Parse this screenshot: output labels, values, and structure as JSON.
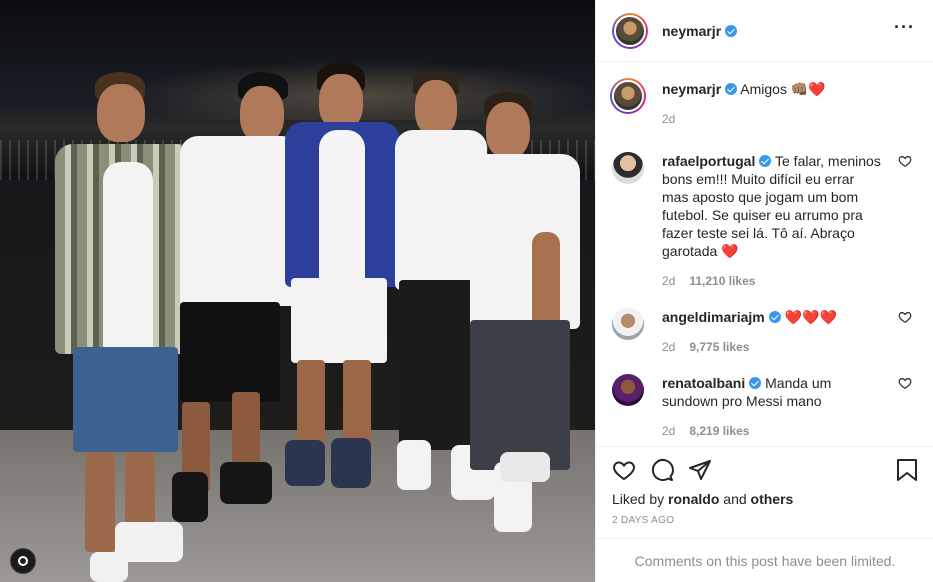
{
  "post": {
    "author": "neymarjr",
    "caption": "Amigos",
    "caption_emojis": "👊🏽❤️",
    "caption_time": "2d"
  },
  "comments": [
    {
      "user": "rafaelportugal",
      "text": "Te falar, meninos bons em!!! Muito difícil eu errar mas aposto que jogam um bom futebol. Se quiser eu arrumo pra fazer teste sei lá. Tô aí. Abraço garotada",
      "emoji": "❤️",
      "time": "2d",
      "likes": "11,210 likes"
    },
    {
      "user": "angeldimariajm",
      "text": "",
      "emoji": "❤️❤️❤️",
      "time": "2d",
      "likes": "9,775 likes"
    },
    {
      "user": "renatoalbani",
      "text": "Manda um sundown pro Messi mano",
      "emoji": "",
      "time": "2d",
      "likes": "8,219 likes"
    }
  ],
  "liked_by": {
    "prefix": "Liked by",
    "user": "ronaldo",
    "joiner": "and",
    "others": "others"
  },
  "date": "2 DAYS AGO",
  "comments_limited": "Comments on this post have been limited.",
  "colors": {
    "verified": "#3897f0",
    "heart": "#ed4956",
    "muted": "#8e8e8e"
  }
}
